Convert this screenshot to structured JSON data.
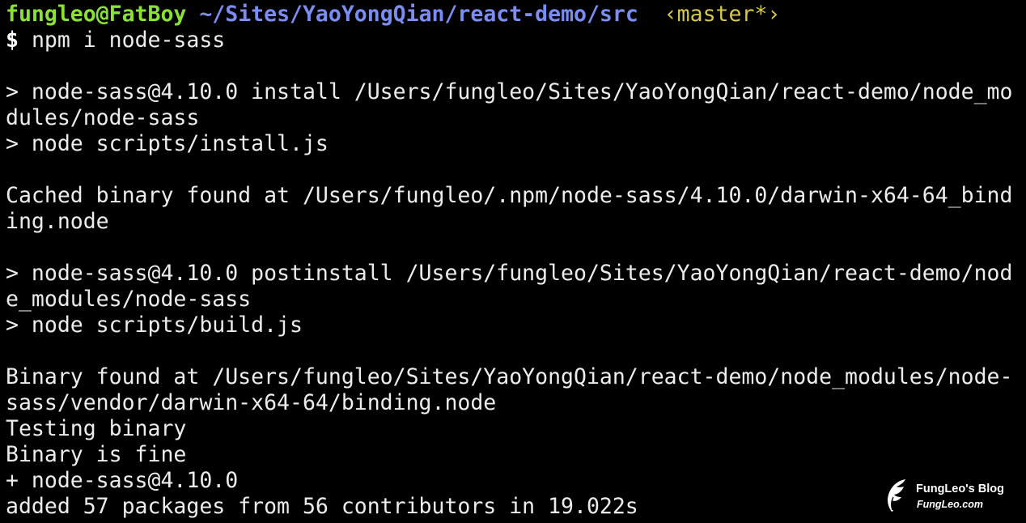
{
  "prompt": {
    "user_host": "fungleo@FatBoy",
    "cwd": "~/Sites/YaoYongQian/react-demo/src",
    "git_branch": "‹master*›",
    "symbol": "$",
    "command": "npm i node-sass"
  },
  "output_lines": [
    "",
    "> node-sass@4.10.0 install /Users/fungleo/Sites/YaoYongQian/react-demo/node_mo",
    "dules/node-sass",
    "> node scripts/install.js",
    "",
    "Cached binary found at /Users/fungleo/.npm/node-sass/4.10.0/darwin-x64-64_bind",
    "ing.node",
    "",
    "> node-sass@4.10.0 postinstall /Users/fungleo/Sites/YaoYongQian/react-demo/nod",
    "e_modules/node-sass",
    "> node scripts/build.js",
    "",
    "Binary found at /Users/fungleo/Sites/YaoYongQian/react-demo/node_modules/node-",
    "sass/vendor/darwin-x64-64/binding.node",
    "Testing binary",
    "Binary is fine",
    "+ node-sass@4.10.0",
    "added 57 packages from 56 contributors in 19.022s"
  ],
  "watermark": {
    "title": "FungLeo's Blog",
    "url": "FungLeo.com",
    "logo_icon": "feather-icon"
  },
  "colors": {
    "background": "#000000",
    "text": "#ececec",
    "user_host": "#8ae234",
    "path": "#7b8cf4",
    "branch": "#d6c84a"
  }
}
